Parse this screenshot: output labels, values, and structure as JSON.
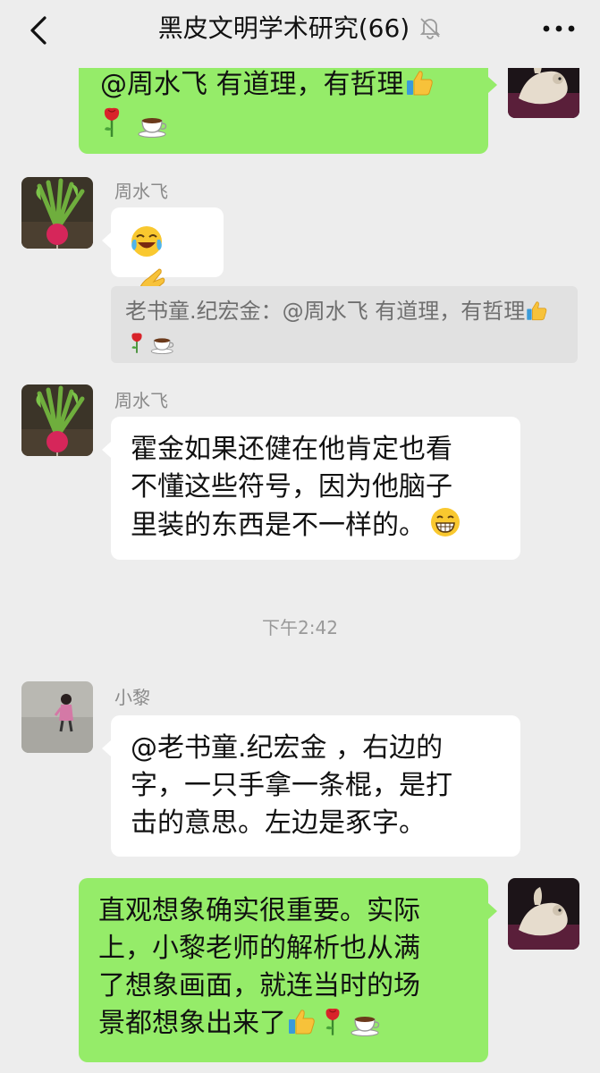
{
  "header": {
    "title": "黑皮文明学术研究(66)",
    "back_icon": "chevron-left-icon",
    "mute_icon": "bell-mute-icon",
    "more_icon": "more-icon"
  },
  "messages": [
    {
      "id": "m1",
      "side": "right",
      "text": "@周水飞  有道理，有哲理",
      "emojis": [
        "thumbs-up",
        "rose",
        "coffee"
      ]
    },
    {
      "id": "m2",
      "side": "left",
      "sender": "周水飞",
      "text": "",
      "emojis": [
        "laughing-crying",
        "ok-hand"
      ],
      "quote": {
        "text": "老书童.纪宏金：@周水飞 有道理，有哲理",
        "emojis": [
          "thumbs-up",
          "rose",
          "coffee"
        ]
      }
    },
    {
      "id": "m3",
      "side": "left",
      "sender": "周水飞",
      "lines": [
        "霍金如果还健在他肯定也看",
        "不懂这些符号，因为他脑子",
        "里装的东西是不一样的。"
      ],
      "emojis": [
        "grinning"
      ]
    },
    {
      "id": "t1",
      "type": "time",
      "text": "下午2:42"
    },
    {
      "id": "m4",
      "side": "left",
      "sender": "小黎",
      "lines": [
        "@老书童.纪宏金 ，右边的",
        "字，一只手拿一条棍，是打",
        "击的意思。左边是豖字。"
      ]
    },
    {
      "id": "m5",
      "side": "right",
      "lines": [
        "直观想象确实很重要。实际",
        "上，小黎老师的解析也从满",
        "了想象画面，就连当时的场",
        "景都想象出来了"
      ],
      "emojis": [
        "thumbs-up",
        "rose",
        "coffee"
      ]
    }
  ],
  "colors": {
    "background": "#ededed",
    "self_bubble": "#95ec69",
    "other_bubble": "#ffffff",
    "quote_bg": "#e1e1e1"
  }
}
